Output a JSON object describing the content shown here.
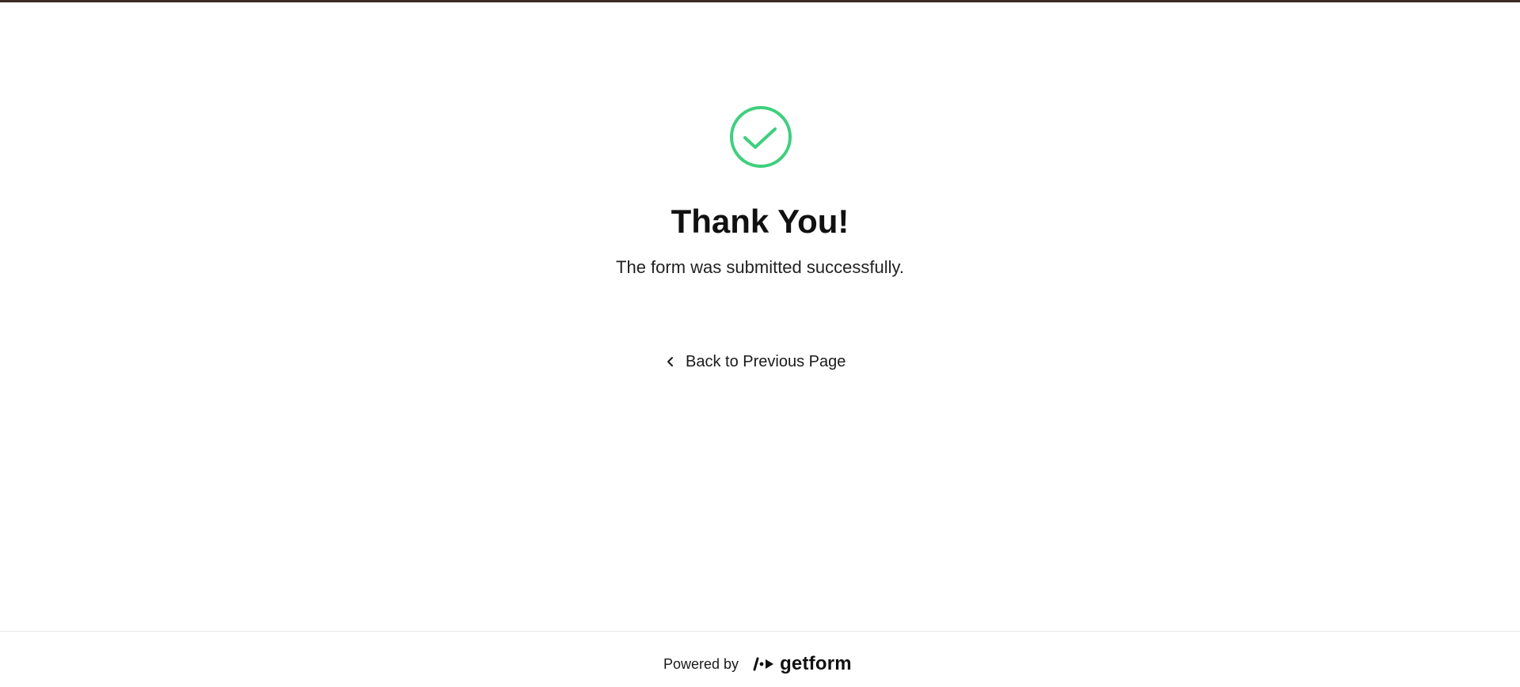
{
  "colors": {
    "accent_success": "#3ecf7e",
    "top_bar": "#3b2a25",
    "text_primary": "#111111"
  },
  "icons": {
    "success": "check-circle-icon",
    "back": "chevron-left-icon",
    "brand": "getform-logo-icon"
  },
  "message": {
    "title": "Thank You!",
    "subtitle": "The form was submitted successfully."
  },
  "navigation": {
    "back_label": "Back to Previous Page"
  },
  "footer": {
    "powered_by": "Powered by",
    "brand_name": "getform"
  }
}
